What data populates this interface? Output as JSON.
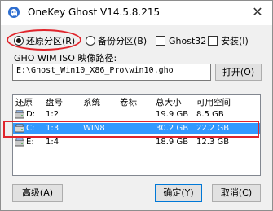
{
  "window": {
    "title": "OneKey Ghost V14.5.8.215",
    "close_glyph": "✕"
  },
  "options": {
    "restore_label": "还原分区(R)",
    "restore_checked": true,
    "backup_label": "备份分区(B)",
    "ghost32_label": "Ghost32",
    "install_label": "安装(I)"
  },
  "path": {
    "label": "GHO WIM ISO 映像路径:",
    "value": "E:\\Ghost_Win10_X86_Pro\\win10.gho",
    "open_button": "打开(O)"
  },
  "partition_table": {
    "columns": [
      "还原",
      "盘号",
      "系统",
      "卷标",
      "总大小",
      "可用空间"
    ],
    "rows": [
      {
        "drive": "D:",
        "number": "1:2",
        "system": "",
        "label": "",
        "total": "19.9 GB",
        "free": "8.5 GB",
        "selected": false
      },
      {
        "drive": "C:",
        "number": "1:3",
        "system": "WIN8",
        "label": "",
        "total": "30.2 GB",
        "free": "22.2 GB",
        "selected": true
      },
      {
        "drive": "E:",
        "number": "1:4",
        "system": "",
        "label": "",
        "total": "18.9 GB",
        "free": "12.3 GB",
        "selected": false
      }
    ]
  },
  "buttons": {
    "advanced": "高级(A)",
    "ok": "确定(Y)",
    "cancel": "取消(C)"
  },
  "colors": {
    "selection": "#3399ff",
    "annotation_red": "#e0242b",
    "default_button_border": "#0078d7"
  },
  "icons": {
    "app": "ghost-app-icon",
    "drive": "hard-drive-icon"
  }
}
